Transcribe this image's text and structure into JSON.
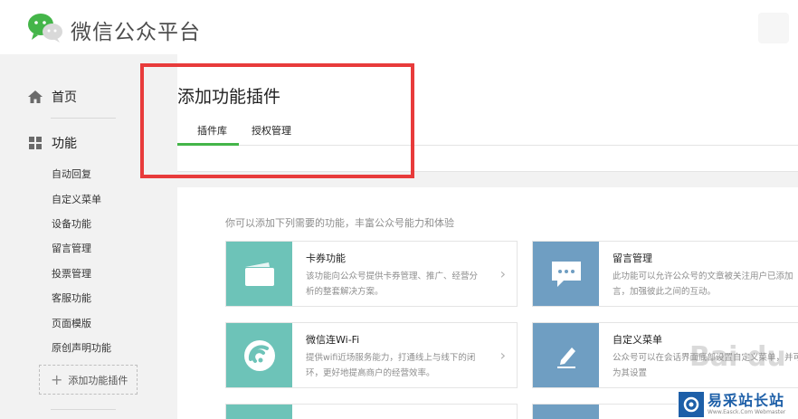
{
  "header": {
    "brand": "微信公众平台"
  },
  "sidebar": {
    "home_label": "首页",
    "functions_label": "功能",
    "items": [
      "自动回复",
      "自定义菜单",
      "设备功能",
      "留言管理",
      "投票管理",
      "客服功能",
      "页面模版",
      "原创声明功能"
    ],
    "add_plugin_label": "添加功能插件"
  },
  "main": {
    "title": "添加功能插件",
    "tabs": [
      {
        "label": "插件库",
        "active": true
      },
      {
        "label": "授权管理",
        "active": false
      }
    ],
    "intro": "你可以添加下列需要的功能，丰富公众号能力和体验",
    "plugins": [
      {
        "title": "卡券功能",
        "desc": "该功能向公众号提供卡券管理、推广、经营分析的整套解决方案。",
        "icon": "card-icon",
        "color": "#6dc3b8"
      },
      {
        "title": "留言管理",
        "desc": "此功能可以允许公众号的文章被关注用户已添加言，加强彼此之间的互动。",
        "icon": "message-icon",
        "color": "#6f9ec2"
      },
      {
        "title": "微信连Wi-Fi",
        "desc": "提供wifi近场服务能力，打通线上与线下的闭环，更好地提高商户的经营效率。",
        "icon": "wifi-icon",
        "color": "#6dc3b8"
      },
      {
        "title": "自定义菜单",
        "desc": "公众号可以在会话界面底部设置自定义菜单，并可为其设置",
        "icon": "edit-icon",
        "color": "#6f9ec2"
      }
    ]
  },
  "watermark": {
    "main": "易采站长站",
    "sub": "Www.Easck.Com Webmaster",
    "baidu": "Bai du"
  },
  "colors": {
    "accent_green": "#44b549",
    "highlight_red": "#e83b3b",
    "teal_tile": "#6dc3b8",
    "blue_tile": "#6f9ec2"
  }
}
